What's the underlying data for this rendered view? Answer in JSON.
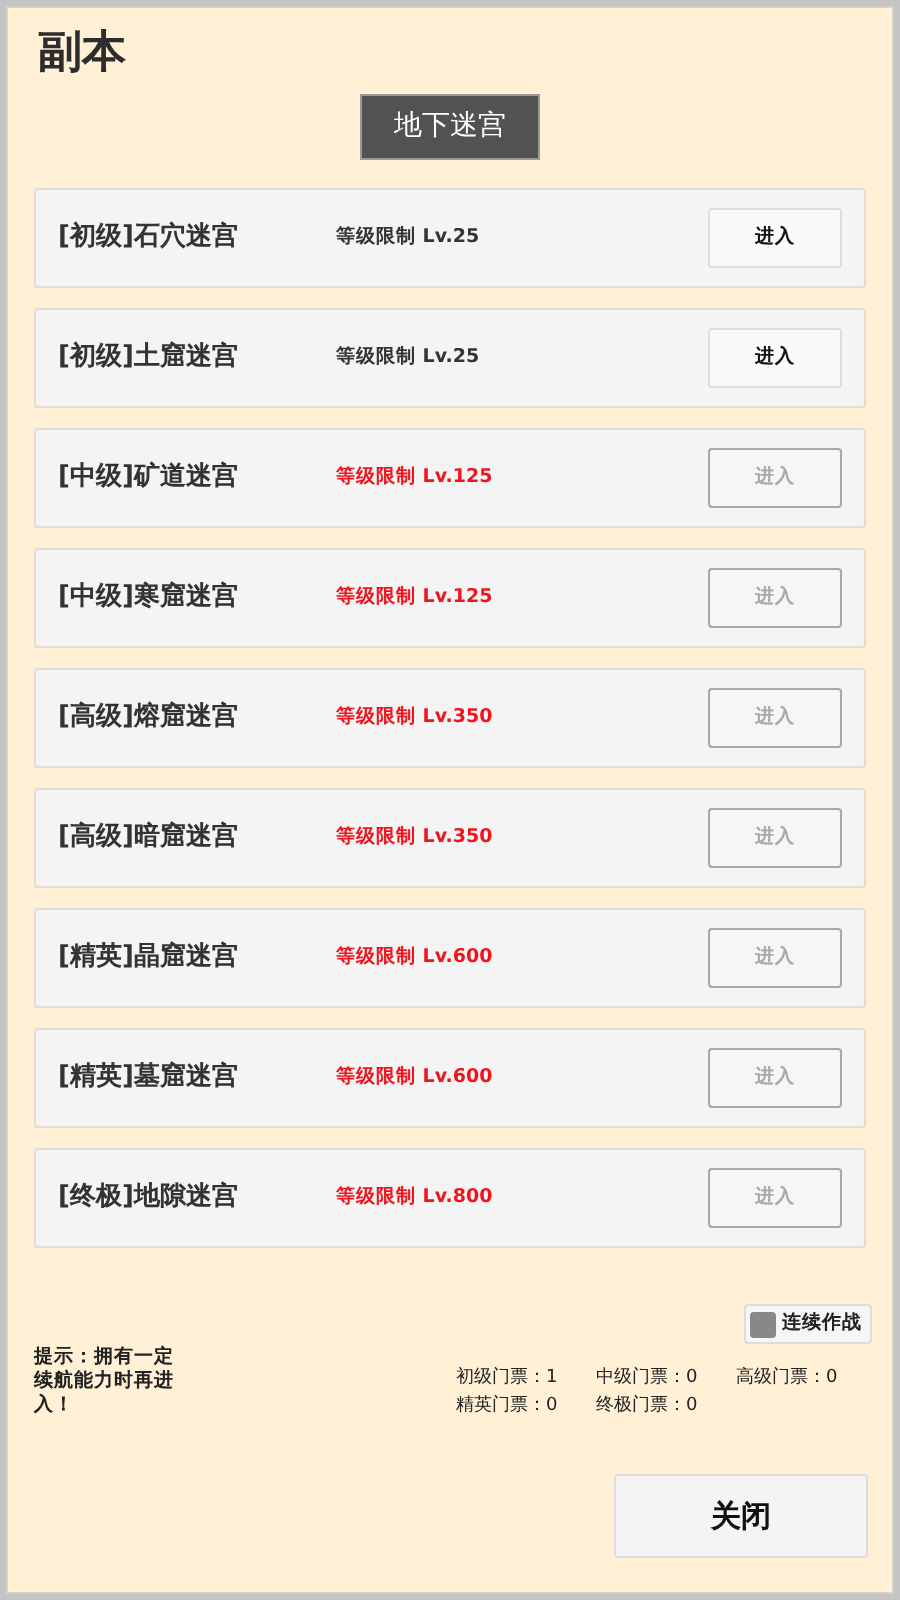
{
  "title": "副本",
  "tab": {
    "label": "地下迷宫",
    "selected": true
  },
  "dungeons": [
    {
      "name": "[初级]石穴迷宫",
      "requirement": "等级限制 Lv.25",
      "locked": false,
      "button": "进入"
    },
    {
      "name": "[初级]土窟迷宫",
      "requirement": "等级限制 Lv.25",
      "locked": false,
      "button": "进入"
    },
    {
      "name": "[中级]矿道迷宫",
      "requirement": "等级限制 Lv.125",
      "locked": true,
      "button": "进入"
    },
    {
      "name": "[中级]寒窟迷宫",
      "requirement": "等级限制 Lv.125",
      "locked": true,
      "button": "进入"
    },
    {
      "name": "[高级]熔窟迷宫",
      "requirement": "等级限制 Lv.350",
      "locked": true,
      "button": "进入"
    },
    {
      "name": "[高级]暗窟迷宫",
      "requirement": "等级限制 Lv.350",
      "locked": true,
      "button": "进入"
    },
    {
      "name": "[精英]晶窟迷宫",
      "requirement": "等级限制 Lv.600",
      "locked": true,
      "button": "进入"
    },
    {
      "name": "[精英]墓窟迷宫",
      "requirement": "等级限制 Lv.600",
      "locked": true,
      "button": "进入"
    },
    {
      "name": "[终极]地隙迷宫",
      "requirement": "等级限制 Lv.800",
      "locked": true,
      "button": "进入"
    }
  ],
  "auto_battle": {
    "label": "连续作战",
    "checked": false
  },
  "tip": "提示：拥有一定续航能力时再进入！",
  "tickets": [
    "初级门票：1",
    "中级门票：0",
    "高级门票：0",
    "精英门票：0",
    "终极门票：0"
  ],
  "close_button": "关闭"
}
